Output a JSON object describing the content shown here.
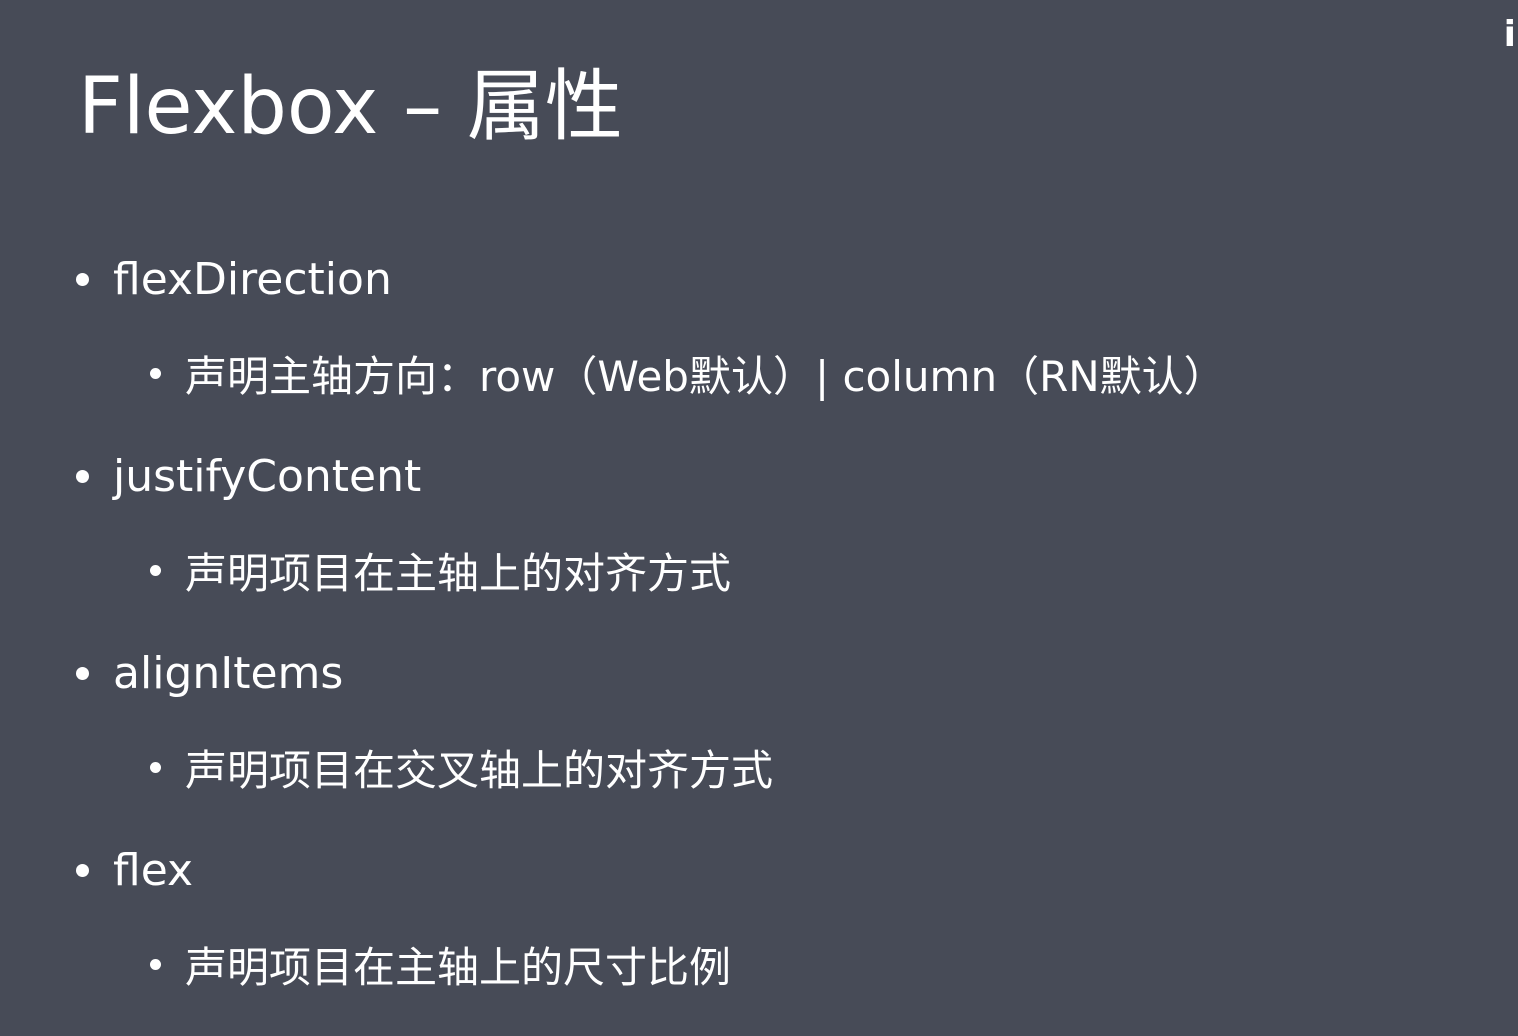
{
  "slide": {
    "title": "Flexbox – 属性",
    "corner_mark": "i",
    "items": [
      {
        "property": "flexDirection",
        "description": "声明主轴方向：row（Web默认）| column（RN默认）"
      },
      {
        "property": "justifyContent",
        "description": "声明项目在主轴上的对齐方式"
      },
      {
        "property": "alignItems",
        "description": "声明项目在交叉轴上的对齐方式"
      },
      {
        "property": "flex",
        "description": "声明项目在主轴上的尺寸比例"
      }
    ]
  },
  "colors": {
    "background": "#474b57",
    "text": "#ffffff"
  }
}
